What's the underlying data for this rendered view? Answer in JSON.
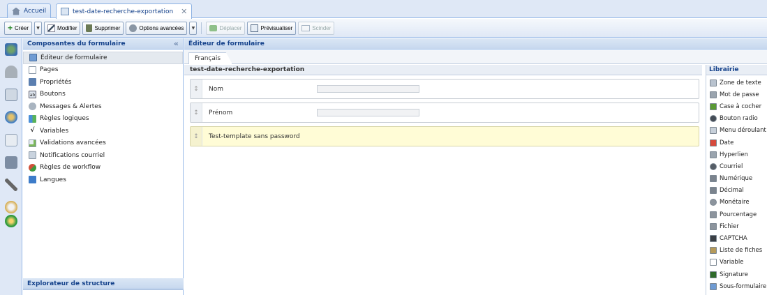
{
  "tabs": [
    {
      "label": "Accueil",
      "icon": "home-icon"
    },
    {
      "label": "test-date-recherche-exportation",
      "icon": "form-icon",
      "close": "✕"
    }
  ],
  "toolbar": {
    "create": "Créer",
    "modify": "Modifier",
    "delete": "Supprimer",
    "advanced": "Options avancées",
    "move": "Déplacer",
    "preview": "Prévisualiser",
    "split": "Scinder"
  },
  "components": {
    "title": "Composantes du formulaire",
    "collapse": "«",
    "items": [
      {
        "label": "Éditeur de formulaire",
        "icon": "form-editor-icon",
        "color": "#6f9bd3"
      },
      {
        "label": "Pages",
        "icon": "page-icon",
        "color": "#ffffff"
      },
      {
        "label": "Propriétés",
        "icon": "properties-icon",
        "color": "#5b7fb0"
      },
      {
        "label": "Boutons",
        "icon": "button-icon",
        "color": "#dfe6ef"
      },
      {
        "label": "Messages & Alertes",
        "icon": "message-icon",
        "color": "#a9b4c0"
      },
      {
        "label": "Règles logiques",
        "icon": "logic-rules-icon",
        "color": "#4a8fd8"
      },
      {
        "label": "Variables",
        "icon": "variable-icon",
        "color": "#ffffff"
      },
      {
        "label": "Validations avancées",
        "icon": "validation-icon",
        "color": "#7cb85a"
      },
      {
        "label": "Notifications courriel",
        "icon": "email-icon",
        "color": "#c9d3de"
      },
      {
        "label": "Règles de workflow",
        "icon": "workflow-icon",
        "color": "#d0503a"
      },
      {
        "label": "Langues",
        "icon": "language-icon",
        "color": "#3d7cc9"
      }
    ]
  },
  "explorer": {
    "title": "Explorateur de structure"
  },
  "editor": {
    "title": "Éditeur de formulaire",
    "lang_tab": "Français",
    "form_name": "test-date-recherche-exportation",
    "fields": [
      {
        "label": "Nom",
        "type": "text"
      },
      {
        "label": "Prénom",
        "type": "text"
      },
      {
        "label": "Test-template sans password",
        "type": "note"
      }
    ]
  },
  "library": {
    "title": "Librairie",
    "items": [
      {
        "label": "Zone de texte",
        "icon": "textarea-icon",
        "color": "#b9c3cf"
      },
      {
        "label": "Mot de passe",
        "icon": "password-icon",
        "color": "#9aa4ae"
      },
      {
        "label": "Case à cocher",
        "icon": "checkbox-icon",
        "color": "#5a9a34"
      },
      {
        "label": "Bouton radio",
        "icon": "radio-icon",
        "color": "#444c56"
      },
      {
        "label": "Menu déroulant",
        "icon": "dropdown-icon",
        "color": "#c7d0da"
      },
      {
        "label": "Date",
        "icon": "date-icon",
        "color": "#d64a3c"
      },
      {
        "label": "Hyperlien",
        "icon": "link-icon",
        "color": "#9aa4ae"
      },
      {
        "label": "Courriel",
        "icon": "at-icon",
        "color": "#555d66"
      },
      {
        "label": "Numérique",
        "icon": "numeric-icon",
        "color": "#7a838d"
      },
      {
        "label": "Décimal",
        "icon": "decimal-icon",
        "color": "#7a838d"
      },
      {
        "label": "Monétaire",
        "icon": "currency-icon",
        "color": "#8c949d"
      },
      {
        "label": "Pourcentage",
        "icon": "percent-icon",
        "color": "#8c949d"
      },
      {
        "label": "Fichier",
        "icon": "attachment-icon",
        "color": "#8c949d"
      },
      {
        "label": "CAPTCHA",
        "icon": "captcha-icon",
        "color": "#3a3f45"
      },
      {
        "label": "Liste de fiches",
        "icon": "list-icon",
        "color": "#b59a5a"
      },
      {
        "label": "Variable",
        "icon": "variable-icon",
        "color": "#ffffff"
      },
      {
        "label": "Signature",
        "icon": "signature-icon",
        "color": "#2f6b2a"
      },
      {
        "label": "Sous-formulaire",
        "icon": "subform-icon",
        "color": "#6f9bd3"
      }
    ]
  }
}
